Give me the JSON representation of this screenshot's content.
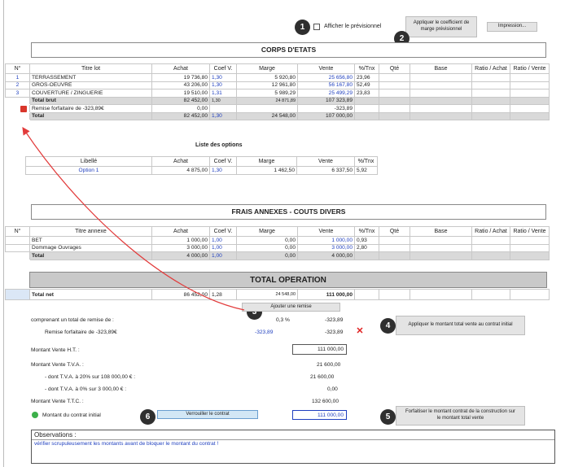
{
  "toolbar": {
    "checkbox_label": "Afficher le prévisionnel",
    "coef_button": "Appliquer le coefficient de marge prévisionnel",
    "print_button": "Impression..."
  },
  "badges": [
    "1",
    "2",
    "3",
    "4",
    "5",
    "6"
  ],
  "corps": {
    "title": "CORPS D'ETATS",
    "headers": [
      "N°",
      "Titre lot",
      "Achat",
      "Coef V.",
      "Marge",
      "Vente",
      "%/Tnx",
      "Qté",
      "Base",
      "Ratio / Achat",
      "Ratio / Vente"
    ],
    "rows": [
      {
        "n": "1",
        "titre": "TERRASSEMENT",
        "achat": "19 736,80",
        "coef": "1,30",
        "marge": "5 920,80",
        "vente": "25 656,80",
        "pct": "23,96"
      },
      {
        "n": "2",
        "titre": "GROS-OEUVRE",
        "achat": "43 206,00",
        "coef": "1,30",
        "marge": "12 961,80",
        "vente": "56 167,80",
        "pct": "52,49"
      },
      {
        "n": "3",
        "titre": "COUVERTURE / ZINGUERIE",
        "achat": "19 510,00",
        "coef": "1,31",
        "marge": "5 989,29",
        "vente": "25 499,29",
        "pct": "23,83"
      }
    ],
    "total_brut": {
      "label": "Total brut",
      "achat": "82 452,00",
      "coef": "1,30",
      "marge": "24 871,89",
      "vente": "107 323,89"
    },
    "remise": {
      "label": "Remise forfaitaire de -323,89€",
      "achat": "0,00",
      "vente": "-323,89"
    },
    "total": {
      "label": "Total",
      "achat": "82 452,00",
      "coef": "1,30",
      "marge": "24 548,00",
      "vente": "107 000,00"
    }
  },
  "options": {
    "title": "Liste des options",
    "headers": [
      "Libellé",
      "Achat",
      "Coef V.",
      "Marge",
      "Vente",
      "%/Tnx"
    ],
    "rows": [
      {
        "libelle": "Option 1",
        "achat": "4 875,00",
        "coef": "1,30",
        "marge": "1 462,50",
        "vente": "6 337,50",
        "pct": "5,92"
      }
    ]
  },
  "frais": {
    "title": "FRAIS ANNEXES - COUTS DIVERS",
    "headers": [
      "N°",
      "Titre annexe",
      "Achat",
      "Coef V.",
      "Marge",
      "Vente",
      "%/Tnx",
      "Qté",
      "Base",
      "Ratio / Achat",
      "Ratio / Vente"
    ],
    "rows": [
      {
        "titre": "BET",
        "achat": "1 000,00",
        "coef": "1,00",
        "marge": "0,00",
        "vente": "1 000,00",
        "pct": "0,93"
      },
      {
        "titre": "Dommage Ouvrages",
        "achat": "3 000,00",
        "coef": "1,00",
        "marge": "0,00",
        "vente": "3 000,00",
        "pct": "2,80"
      }
    ],
    "total": {
      "label": "Total",
      "achat": "4 000,00",
      "coef": "1,00",
      "marge": "0,00",
      "vente": "4 000,00"
    }
  },
  "operation": {
    "title": "TOTAL OPERATION",
    "total_net": {
      "label": "Total net",
      "achat": "86 452,00",
      "coef": "1,28",
      "marge": "24 548,00",
      "vente": "111 000,00"
    }
  },
  "summary": {
    "add_remise_button": "Ajouter une remise",
    "remise_total_label": "comprenant un total de remise de :",
    "remise_total_pct": "0,3 %",
    "remise_total_value": "-323,89",
    "remise_line_label": "Remise forfaitaire de -323,89€",
    "remise_line_pct": "-323,89",
    "remise_line_value": "-323,89",
    "apply_total_button": "Appliquer le montant total vente au contrat initial",
    "ht_label": "Montant Vente H.T. :",
    "ht_value": "111 000,00",
    "tva_label": "Montant Vente T.V.A. :",
    "tva_value": "21 600,00",
    "tva20_label": "- dont T.V.A. à 20% sur 108 000,00 € :",
    "tva20_value": "21 600,00",
    "tva0_label": "- dont T.V.A. à 0% sur 3 000,00 € :",
    "tva0_value": "0,00",
    "ttc_label": "Montant Vente T.T.C. :",
    "ttc_value": "132 600,00",
    "contrat_label": "Montant du contrat initial",
    "lock_button": "Verrouiller le contrat",
    "contrat_value": "111 000,00",
    "forfait_button": "Forfaitiser le montant contrat de la construction sur le montant total vente"
  },
  "observations": {
    "title": "Observations :",
    "text": "vérifier scrupuleusement les montants avant de bloquer le montant du contrat !"
  },
  "colors": {
    "accent_blue": "#1f3fbf",
    "red_arrow": "#e23b3b",
    "grey_row": "#d9d9d9"
  }
}
